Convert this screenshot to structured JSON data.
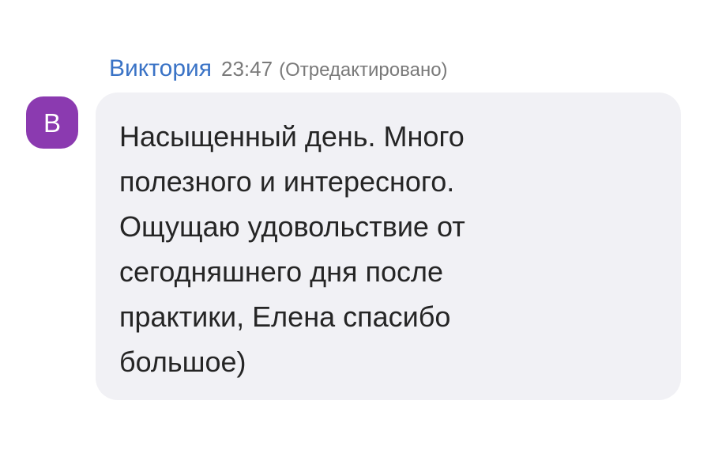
{
  "message": {
    "sender": "Виктория",
    "time": "23:47",
    "edited_label": "(Отредактировано)",
    "avatar": {
      "initial": "В",
      "color": "#8b3ab0"
    },
    "text": "Насыщенный день. Много\nполезного и интересного.\nОщущаю удовольствие от\nсегодняшнего дня после\nпрактики, Елена спасибо\nбольшое)"
  },
  "colors": {
    "sender_name": "#3a73c6",
    "meta_text": "#7a7a7a",
    "bubble_background": "#f1f1f5"
  }
}
